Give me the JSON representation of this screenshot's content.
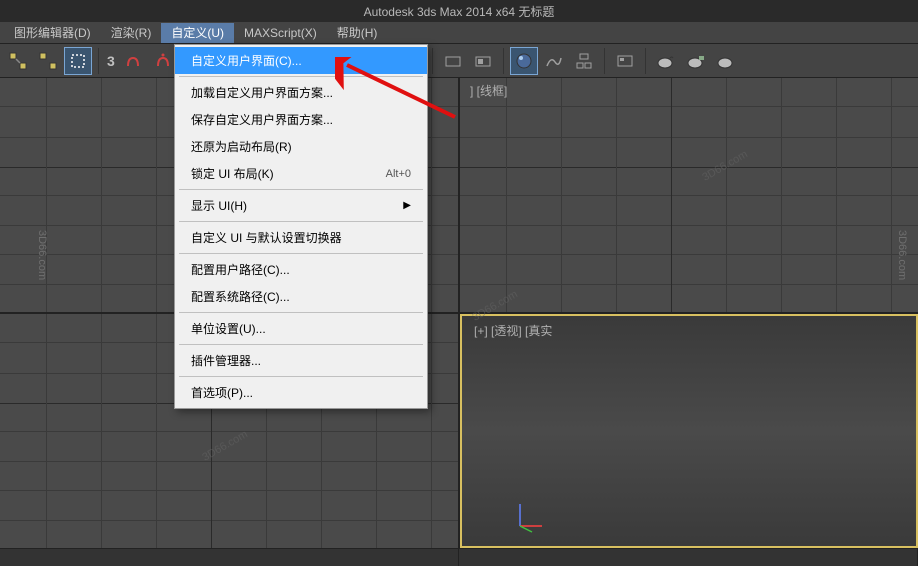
{
  "app": {
    "title": "Autodesk 3ds Max  2014 x64      无标题"
  },
  "menubar": {
    "items": [
      {
        "label": "图形编辑器(D)"
      },
      {
        "label": "渲染(R)"
      },
      {
        "label": "自定义(U)"
      },
      {
        "label": "MAXScript(X)"
      },
      {
        "label": "帮助(H)"
      }
    ]
  },
  "dropdown": {
    "items": [
      {
        "label": "自定义用户界面(C)...",
        "highlight": true
      },
      {
        "sep": true
      },
      {
        "label": "加载自定义用户界面方案..."
      },
      {
        "label": "保存自定义用户界面方案..."
      },
      {
        "label": "还原为启动布局(R)"
      },
      {
        "label": "锁定 UI 布局(K)",
        "shortcut": "Alt+0"
      },
      {
        "sep": true
      },
      {
        "label": "显示 UI(H)",
        "submenu": true
      },
      {
        "sep": true
      },
      {
        "label": "自定义 UI 与默认设置切换器"
      },
      {
        "sep": true
      },
      {
        "label": "配置用户路径(C)..."
      },
      {
        "label": "配置系统路径(C)..."
      },
      {
        "sep": true
      },
      {
        "label": "单位设置(U)..."
      },
      {
        "sep": true
      },
      {
        "label": "插件管理器..."
      },
      {
        "sep": true
      },
      {
        "label": "首选项(P)..."
      }
    ]
  },
  "viewports": {
    "top_right_label": "] [线框]",
    "bottom_right_label": "[+] [透视] [真实"
  },
  "watermark": "3D66.com"
}
